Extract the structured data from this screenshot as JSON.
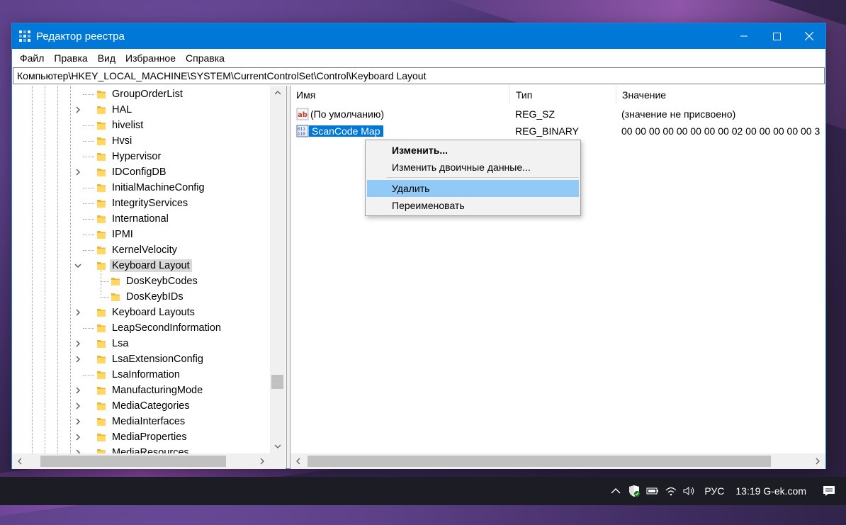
{
  "window": {
    "title": "Редактор реестра",
    "accent": "#0078d7"
  },
  "menubar": {
    "items": [
      {
        "label": "Файл"
      },
      {
        "label": "Правка"
      },
      {
        "label": "Вид"
      },
      {
        "label": "Избранное"
      },
      {
        "label": "Справка"
      }
    ]
  },
  "address": {
    "path": "Компьютер\\HKEY_LOCAL_MACHINE\\SYSTEM\\CurrentControlSet\\Control\\Keyboard Layout"
  },
  "tree": {
    "items": [
      {
        "label": "GroupOrderList",
        "expander": "none",
        "level": 0
      },
      {
        "label": "HAL",
        "expander": "collapsed",
        "level": 0
      },
      {
        "label": "hivelist",
        "expander": "none",
        "level": 0
      },
      {
        "label": "Hvsi",
        "expander": "none",
        "level": 0
      },
      {
        "label": "Hypervisor",
        "expander": "none",
        "level": 0
      },
      {
        "label": "IDConfigDB",
        "expander": "collapsed",
        "level": 0
      },
      {
        "label": "InitialMachineConfig",
        "expander": "none",
        "level": 0
      },
      {
        "label": "IntegrityServices",
        "expander": "none",
        "level": 0
      },
      {
        "label": "International",
        "expander": "none",
        "level": 0
      },
      {
        "label": "IPMI",
        "expander": "none",
        "level": 0
      },
      {
        "label": "KernelVelocity",
        "expander": "none",
        "level": 0
      },
      {
        "label": "Keyboard Layout",
        "expander": "expanded",
        "level": 0,
        "selected": true
      },
      {
        "label": "DosKeybCodes",
        "expander": "none",
        "level": 1
      },
      {
        "label": "DosKeybIDs",
        "expander": "none",
        "level": 1
      },
      {
        "label": "Keyboard Layouts",
        "expander": "collapsed",
        "level": 0
      },
      {
        "label": "LeapSecondInformation",
        "expander": "none",
        "level": 0
      },
      {
        "label": "Lsa",
        "expander": "collapsed",
        "level": 0
      },
      {
        "label": "LsaExtensionConfig",
        "expander": "collapsed",
        "level": 0
      },
      {
        "label": "LsaInformation",
        "expander": "none",
        "level": 0
      },
      {
        "label": "ManufacturingMode",
        "expander": "collapsed",
        "level": 0
      },
      {
        "label": "MediaCategories",
        "expander": "collapsed",
        "level": 0
      },
      {
        "label": "MediaInterfaces",
        "expander": "collapsed",
        "level": 0
      },
      {
        "label": "MediaProperties",
        "expander": "collapsed",
        "level": 0
      },
      {
        "label": "MediaResources",
        "expander": "collapsed",
        "level": 0
      }
    ]
  },
  "list": {
    "columns": {
      "name": "Имя",
      "type": "Тип",
      "value": "Значение"
    },
    "rows": [
      {
        "icon": "string-value-icon",
        "name": "(По умолчанию)",
        "type": "REG_SZ",
        "value": "(значение не присвоено)"
      },
      {
        "icon": "binary-value-icon",
        "name": "ScanCode Map",
        "type": "REG_BINARY",
        "value": "00 00 00 00 00 00 00 00 02 00 00 00 00 00 3",
        "selected": true
      }
    ]
  },
  "context_menu": {
    "items": [
      {
        "label": "Изменить...",
        "bold": true
      },
      {
        "label": "Изменить двоичные данные..."
      },
      {
        "label": "Удалить",
        "highlighted": true
      },
      {
        "label": "Переименовать"
      }
    ]
  },
  "taskbar": {
    "language": "РУС",
    "clock": "13:19 G-ek.com",
    "tray_icons": [
      "chevron-up-icon",
      "defender-shield-icon",
      "battery-icon",
      "wifi-icon",
      "volume-icon"
    ]
  }
}
